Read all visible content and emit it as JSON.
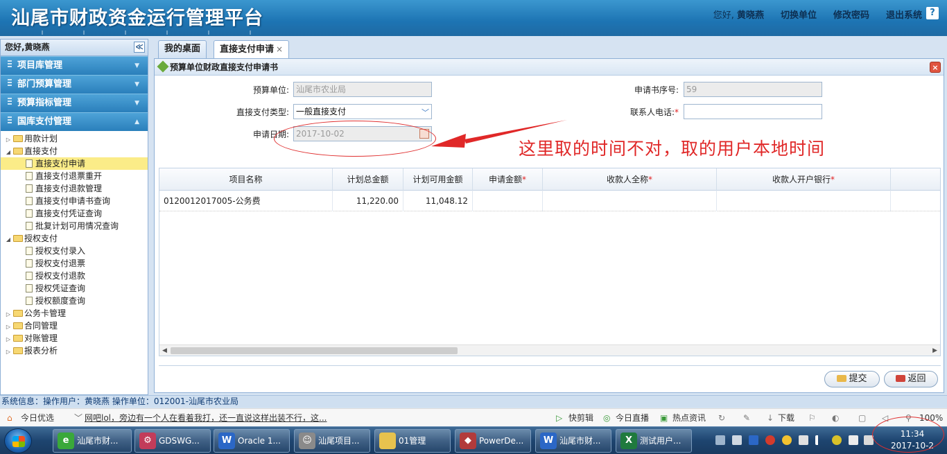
{
  "header": {
    "title": "汕尾市财政资金运行管理平台",
    "greeting": "您好,",
    "user": "黄晓燕",
    "switch_unit": "切换单位",
    "change_password": "修改密码",
    "logout": "退出系统",
    "help": "?"
  },
  "sidebar": {
    "greeting": "您好,黄晓燕",
    "collapse_glyph": "≪",
    "groups": [
      {
        "label": "项目库管理"
      },
      {
        "label": "部门预算管理"
      },
      {
        "label": "预算指标管理"
      },
      {
        "label": "国库支付管理"
      }
    ],
    "tree": [
      {
        "label": "用款计划"
      },
      {
        "label": "直接支付"
      },
      {
        "label": "直接支付申请"
      },
      {
        "label": "直接支付退票重开"
      },
      {
        "label": "直接支付退款管理"
      },
      {
        "label": "直接支付申请书查询"
      },
      {
        "label": "直接支付凭证查询"
      },
      {
        "label": "批复计划可用情况查询"
      },
      {
        "label": "授权支付"
      },
      {
        "label": "授权支付录入"
      },
      {
        "label": "授权支付退票"
      },
      {
        "label": "授权支付退款"
      },
      {
        "label": "授权凭证查询"
      },
      {
        "label": "授权额度查询"
      },
      {
        "label": "公务卡管理"
      },
      {
        "label": "合同管理"
      },
      {
        "label": "对账管理"
      },
      {
        "label": "报表分析"
      }
    ]
  },
  "tabs": [
    {
      "label": "我的桌面"
    },
    {
      "label": "直接支付申请",
      "close": "×"
    }
  ],
  "panel": {
    "title": "预算单位财政直接支付申请书",
    "close": "×",
    "form": {
      "unit_label": "预算单位:",
      "unit_value": "汕尾市农业局",
      "serial_label": "申请书序号:",
      "serial_value": "59",
      "type_label": "直接支付类型:",
      "type_value": "一般直接支付",
      "phone_label": "联系人电话:",
      "phone_value": "",
      "date_label": "申请日期:",
      "date_value": "2017-10-02",
      "required_mark": "*"
    },
    "annotation": "这里取的时间不对，取的用户本地时间",
    "grid": {
      "columns": [
        "项目名称",
        "计划总金额",
        "计划可用金额",
        "申请金额",
        "收款人全称",
        "收款人开户银行"
      ],
      "required_mark": "*",
      "rows": [
        {
          "name": "0120012017005-公务费",
          "total": "11,220.00",
          "available": "11,048.12",
          "apply": "",
          "payee": "",
          "bank": ""
        }
      ]
    },
    "buttons": {
      "submit": "提交",
      "back": "返回"
    }
  },
  "status": {
    "text": "系统信息：操作用户：黄晓燕   操作单位：012001-汕尾市农业局"
  },
  "newsbar": {
    "today": "今日优选",
    "headline": "网吧lol，旁边有一个人在看着我打，还一直说这样出装不行，这...",
    "quick_clip": "快剪辑",
    "live": "今日直播",
    "hot": "热点资讯",
    "download": "下载",
    "zoom": "100%"
  },
  "taskbar": {
    "items": [
      {
        "label": "汕尾市财...",
        "icon": "ie-icon",
        "color": "#3aa83a"
      },
      {
        "label": "GDSWG...",
        "icon": "database-icon",
        "color": "#c23c5a"
      },
      {
        "label": "Oracle 1...",
        "icon": "word-icon",
        "color": "#2b67c6"
      },
      {
        "label": "汕尾项目...",
        "icon": "avatar-icon",
        "color": "#8a8a8a"
      },
      {
        "label": "01管理",
        "icon": "folder-icon",
        "color": "#e7c24e"
      },
      {
        "label": "PowerDe...",
        "icon": "powerdesigner-icon",
        "color": "#b23b3b"
      },
      {
        "label": "汕尾市财...",
        "icon": "word-icon",
        "color": "#2b67c6"
      },
      {
        "label": "测试用户...",
        "icon": "excel-icon",
        "color": "#1f7a3e"
      }
    ],
    "clock_time": "11:34",
    "clock_date": "2017-10-2"
  },
  "colors": {
    "header": "#1d74b3",
    "annotation": "#e02828",
    "selected_node": "#fbec88"
  }
}
